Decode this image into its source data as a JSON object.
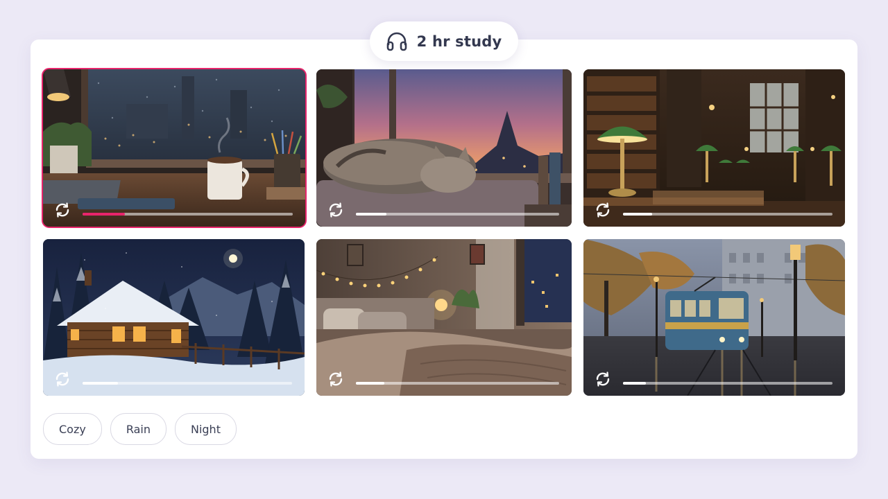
{
  "header": {
    "title": "2 hr study",
    "icon": "headphones-icon"
  },
  "tiles": [
    {
      "scene": "rainy window desk with coffee mug",
      "progress": 0.2,
      "selected": true
    },
    {
      "scene": "sleeping cat by sunset window",
      "progress": 0.15,
      "selected": false
    },
    {
      "scene": "library with green lamps",
      "progress": 0.14,
      "selected": false
    },
    {
      "scene": "snowy cabin at night",
      "progress": 0.17,
      "selected": false
    },
    {
      "scene": "cozy bedroom with fairy lights",
      "progress": 0.14,
      "selected": false
    },
    {
      "scene": "rainy city street with tram",
      "progress": 0.11,
      "selected": false
    }
  ],
  "tile_icon": "loop-icon",
  "tags": [
    "Cozy",
    "Rain",
    "Night"
  ],
  "colors": {
    "accent": "#e8246b",
    "background": "#ece9f6",
    "panel": "#ffffff",
    "text": "#33384f"
  }
}
